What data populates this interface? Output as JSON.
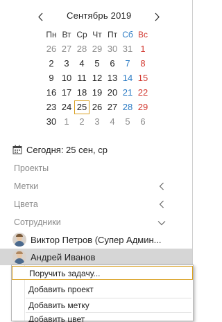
{
  "calendar": {
    "month_title": "Сентябрь 2019",
    "weekdays": [
      "Пн",
      "Вт",
      "Ср",
      "Чт",
      "Пт",
      "Сб",
      "Вс"
    ],
    "weeks": [
      [
        "26",
        "27",
        "28",
        "29",
        "30",
        "31",
        "1"
      ],
      [
        "2",
        "3",
        "4",
        "5",
        "6",
        "7",
        "8"
      ],
      [
        "9",
        "10",
        "11",
        "12",
        "13",
        "14",
        "15"
      ],
      [
        "16",
        "17",
        "18",
        "19",
        "20",
        "21",
        "22"
      ],
      [
        "23",
        "24",
        "25",
        "26",
        "27",
        "28",
        "29"
      ],
      [
        "30",
        "1",
        "2",
        "3",
        "4",
        "5",
        "6"
      ]
    ],
    "today_value": "25"
  },
  "today_label": "Сегодня: 25 сен, ср",
  "sections": {
    "projects": "Проекты",
    "tags": "Метки",
    "colors": "Цвета",
    "employees": "Сотрудники"
  },
  "users": [
    {
      "name": "Виктор Петров (Супер Админ..."
    },
    {
      "name": "Андрей Иванов"
    }
  ],
  "context_menu": {
    "items": [
      "Поручить задачу...",
      "Добавить проект",
      "Добавить метку",
      "Добавить цвет"
    ]
  },
  "colors": {
    "saturday": "#2b7bc4",
    "sunday": "#d2382f",
    "other_month": "#8c8c8c",
    "today_border": "#d9a021",
    "selected_row": "#d6d6d6"
  }
}
